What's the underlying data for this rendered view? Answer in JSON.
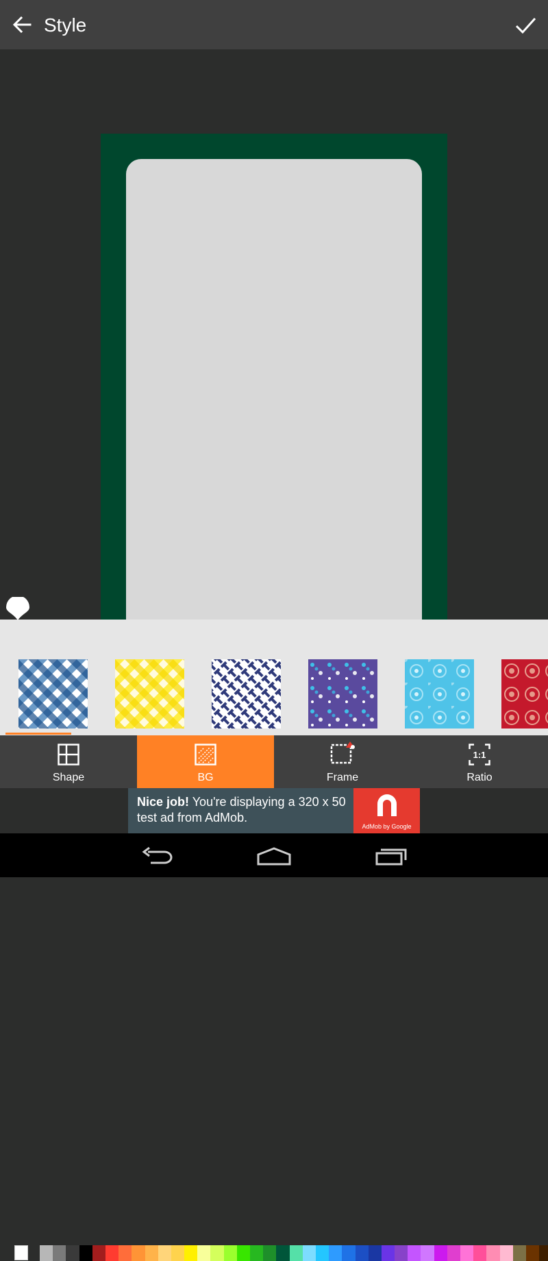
{
  "header": {
    "title": "Style"
  },
  "colors": {
    "accent": "#ff8125",
    "canvas_bg": "#00472d",
    "photo_placeholder": "#d8d8d8",
    "palette": [
      "#b7b7b7",
      "#7a7a7a",
      "#3a3a3a",
      "#000000",
      "#a31d1d",
      "#ff3b30",
      "#ff6d3a",
      "#ff9436",
      "#ffb34a",
      "#ffd57a",
      "#ffd34d",
      "#fff000",
      "#f8ff9a",
      "#d4ff5c",
      "#9aff2e",
      "#38e600",
      "#27b820",
      "#1e8f2a",
      "#00563a",
      "#55e0a8",
      "#7ddcff",
      "#24c6ff",
      "#2e9bff",
      "#1f72e6",
      "#1c4fc4",
      "#1a37a3",
      "#6a34e6",
      "#8742c9",
      "#c455ff",
      "#d077ff",
      "#cc1aee",
      "#e03ecf",
      "#ff73d7",
      "#ff4f9a",
      "#ff8cb3",
      "#ffbad1",
      "#7c7046",
      "#6b3300",
      "#3e1f00"
    ]
  },
  "patterns": [
    {
      "name": "blue-gingham"
    },
    {
      "name": "yellow-gingham"
    },
    {
      "name": "navy-weave"
    },
    {
      "name": "purple-chevron-dots"
    },
    {
      "name": "sky-snowflake"
    },
    {
      "name": "red-ornament"
    }
  ],
  "tabs": [
    {
      "label": "Shape",
      "active": false
    },
    {
      "label": "BG",
      "active": true
    },
    {
      "label": "Frame",
      "active": false
    },
    {
      "label": "Ratio",
      "active": false
    }
  ],
  "ad": {
    "headline": "Nice job!",
    "body_line1": "You're displaying a 320 x 50",
    "body_line2": "test ad from AdMob.",
    "logo_caption": "AdMob by Google"
  }
}
